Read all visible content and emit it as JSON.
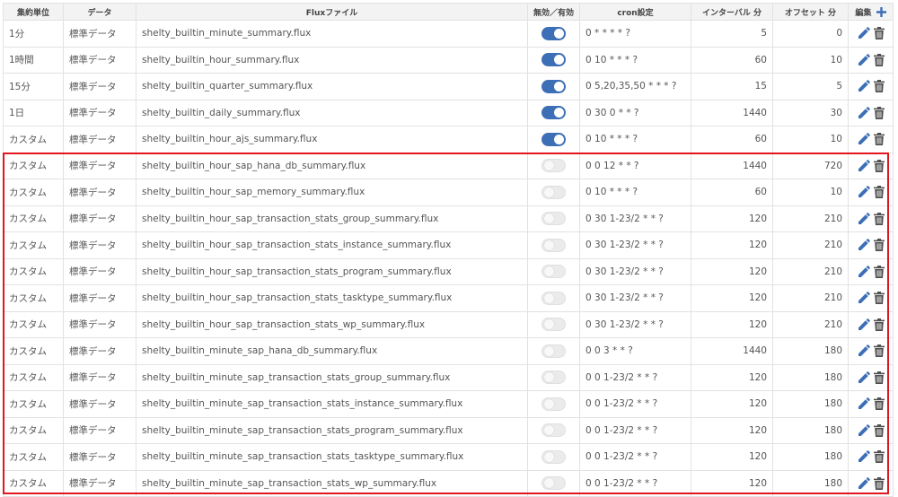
{
  "headers": {
    "unit": "集約単位",
    "data": "データ",
    "flux": "Fluxファイル",
    "enabled": "無効／有効",
    "cron": "cron設定",
    "interval": "インターバル 分",
    "offset": "オフセット 分",
    "edit": "編集"
  },
  "colors": {
    "accent": "#3d6fb6",
    "highlight": "#e3151f",
    "icon": "#4d4d4d"
  },
  "icons": {
    "edit": "pencil-icon",
    "delete": "trash-icon",
    "add": "plus-icon"
  },
  "rows": [
    {
      "unit": "1分",
      "data": "標準データ",
      "flux": "shelty_builtin_minute_summary.flux",
      "enabled": true,
      "cron": "0 * * * * ?",
      "interval": "5",
      "offset": "0"
    },
    {
      "unit": "1時間",
      "data": "標準データ",
      "flux": "shelty_builtin_hour_summary.flux",
      "enabled": true,
      "cron": "0 10 * * * ?",
      "interval": "60",
      "offset": "10"
    },
    {
      "unit": "15分",
      "data": "標準データ",
      "flux": "shelty_builtin_quarter_summary.flux",
      "enabled": true,
      "cron": "0 5,20,35,50 * * * ?",
      "interval": "15",
      "offset": "5"
    },
    {
      "unit": "1日",
      "data": "標準データ",
      "flux": "shelty_builtin_daily_summary.flux",
      "enabled": true,
      "cron": "0 30 0 * * ?",
      "interval": "1440",
      "offset": "30"
    },
    {
      "unit": "カスタム",
      "data": "標準データ",
      "flux": "shelty_builtin_hour_ajs_summary.flux",
      "enabled": true,
      "cron": "0 10 * * * ?",
      "interval": "60",
      "offset": "10"
    },
    {
      "unit": "カスタム",
      "data": "標準データ",
      "flux": "shelty_builtin_hour_sap_hana_db_summary.flux",
      "enabled": false,
      "cron": "0 0 12 * * ?",
      "interval": "1440",
      "offset": "720"
    },
    {
      "unit": "カスタム",
      "data": "標準データ",
      "flux": "shelty_builtin_hour_sap_memory_summary.flux",
      "enabled": false,
      "cron": "0 10 * * * ?",
      "interval": "60",
      "offset": "10"
    },
    {
      "unit": "カスタム",
      "data": "標準データ",
      "flux": "shelty_builtin_hour_sap_transaction_stats_group_summary.flux",
      "enabled": false,
      "cron": "0 30 1-23/2 * * ?",
      "interval": "120",
      "offset": "210"
    },
    {
      "unit": "カスタム",
      "data": "標準データ",
      "flux": "shelty_builtin_hour_sap_transaction_stats_instance_summary.flux",
      "enabled": false,
      "cron": "0 30 1-23/2 * * ?",
      "interval": "120",
      "offset": "210"
    },
    {
      "unit": "カスタム",
      "data": "標準データ",
      "flux": "shelty_builtin_hour_sap_transaction_stats_program_summary.flux",
      "enabled": false,
      "cron": "0 30 1-23/2 * * ?",
      "interval": "120",
      "offset": "210"
    },
    {
      "unit": "カスタム",
      "data": "標準データ",
      "flux": "shelty_builtin_hour_sap_transaction_stats_tasktype_summary.flux",
      "enabled": false,
      "cron": "0 30 1-23/2 * * ?",
      "interval": "120",
      "offset": "210"
    },
    {
      "unit": "カスタム",
      "data": "標準データ",
      "flux": "shelty_builtin_hour_sap_transaction_stats_wp_summary.flux",
      "enabled": false,
      "cron": "0 30 1-23/2 * * ?",
      "interval": "120",
      "offset": "210"
    },
    {
      "unit": "カスタム",
      "data": "標準データ",
      "flux": "shelty_builtin_minute_sap_hana_db_summary.flux",
      "enabled": false,
      "cron": "0 0 3 * * ?",
      "interval": "1440",
      "offset": "180"
    },
    {
      "unit": "カスタム",
      "data": "標準データ",
      "flux": "shelty_builtin_minute_sap_transaction_stats_group_summary.flux",
      "enabled": false,
      "cron": "0 0 1-23/2 * * ?",
      "interval": "120",
      "offset": "180"
    },
    {
      "unit": "カスタム",
      "data": "標準データ",
      "flux": "shelty_builtin_minute_sap_transaction_stats_instance_summary.flux",
      "enabled": false,
      "cron": "0 0 1-23/2 * * ?",
      "interval": "120",
      "offset": "180"
    },
    {
      "unit": "カスタム",
      "data": "標準データ",
      "flux": "shelty_builtin_minute_sap_transaction_stats_program_summary.flux",
      "enabled": false,
      "cron": "0 0 1-23/2 * * ?",
      "interval": "120",
      "offset": "180"
    },
    {
      "unit": "カスタム",
      "data": "標準データ",
      "flux": "shelty_builtin_minute_sap_transaction_stats_tasktype_summary.flux",
      "enabled": false,
      "cron": "0 0 1-23/2 * * ?",
      "interval": "120",
      "offset": "180"
    },
    {
      "unit": "カスタム",
      "data": "標準データ",
      "flux": "shelty_builtin_minute_sap_transaction_stats_wp_summary.flux",
      "enabled": false,
      "cron": "0 0 1-23/2 * * ?",
      "interval": "120",
      "offset": "180"
    }
  ]
}
